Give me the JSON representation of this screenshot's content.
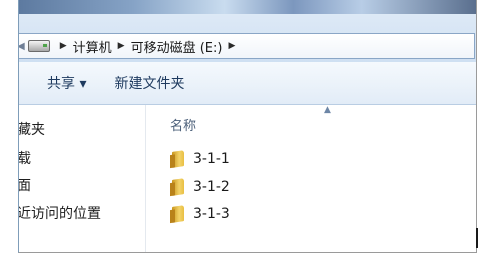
{
  "address_bar": {
    "back_arrow_icon": "chevron-left",
    "drive_icon": "removable-drive",
    "crumbs": [
      "计算机",
      "可移动磁盘 (E:)"
    ]
  },
  "toolbar": {
    "share_label": "共享 ▾",
    "new_folder_label": "新建文件夹"
  },
  "nav_pane": {
    "items": [
      "藏夹",
      "载",
      "面",
      "近访问的位置"
    ]
  },
  "file_list": {
    "column_header": "名称",
    "items": [
      {
        "name": "3-1-1",
        "icon": "folder-icon"
      },
      {
        "name": "3-1-2",
        "icon": "folder-icon"
      },
      {
        "name": "3-1-3",
        "icon": "folder-icon"
      }
    ]
  },
  "colors": {
    "toolbar_text": "#1e3a5f",
    "address_bg": "#dde9f6",
    "folder": "#e9bf43"
  }
}
